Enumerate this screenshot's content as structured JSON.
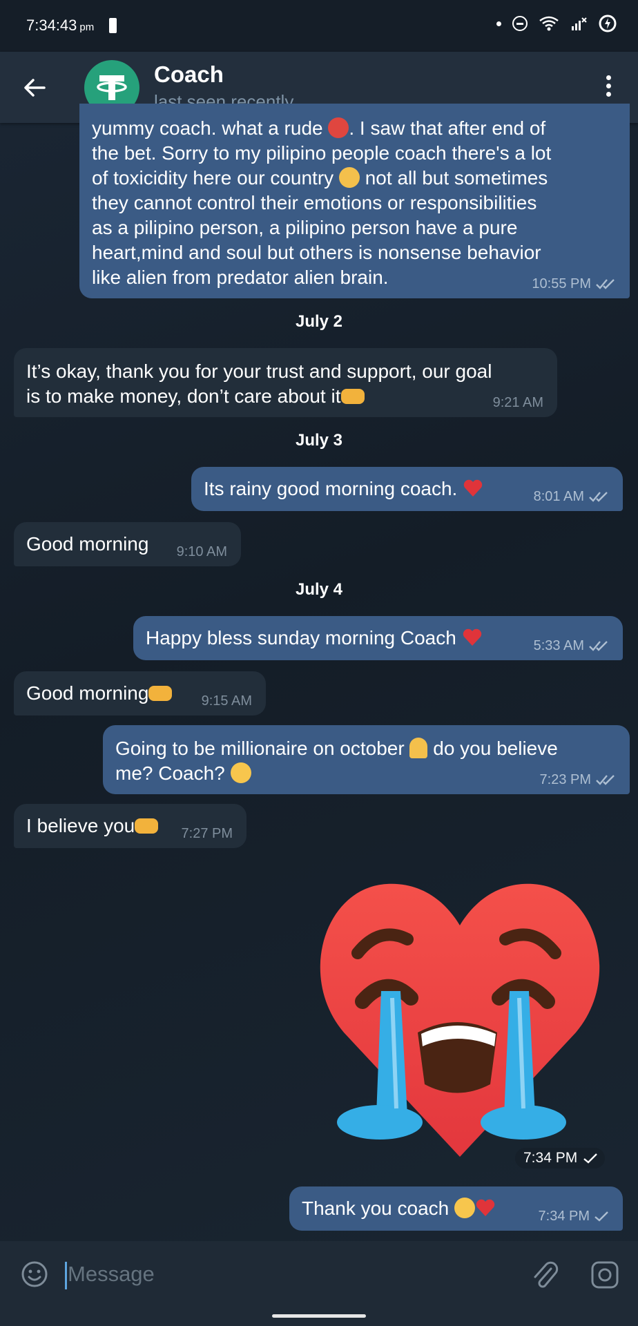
{
  "status_bar": {
    "time": "7:34:43",
    "ampm": "pm"
  },
  "header": {
    "title": "Coach",
    "subtitle": "last seen recently"
  },
  "messages": {
    "m1": {
      "line1": "yummy coach. what a rude",
      "line1b": ". I saw that after end of",
      "line2": "the bet. Sorry to my pilipino people coach there's a lot",
      "line3a": "of toxicidity here our country",
      "line3b": "not all but sometimes",
      "line4": "they cannot control their emotions or responsibilities",
      "line5": "as a pilipino person, a pilipino person have a pure",
      "line6": "heart,mind and soul but others is nonsense behavior",
      "line7": "like alien from predator alien brain.",
      "time": "10:55 PM"
    },
    "date1": "July 2",
    "m2": {
      "line1": "It’s okay, thank you for your trust and support, our goal",
      "line2": "is to make money, don’t care about it",
      "time": "9:21 AM"
    },
    "date2": "July 3",
    "m3": {
      "text": "Its rainy good morning coach.",
      "time": "8:01 AM"
    },
    "m4": {
      "text": "Good morning",
      "time": "9:10 AM"
    },
    "date3": "July 4",
    "m5": {
      "text": "Happy bless sunday morning Coach",
      "time": "5:33 AM"
    },
    "m6": {
      "text": "Good morning",
      "time": "9:15 AM"
    },
    "m7": {
      "line1a": "Going to be millionaire on october",
      "line1b": "do you believe",
      "line2": "me? Coach?",
      "time": "7:23 PM"
    },
    "m8": {
      "text": "I believe you",
      "time": "7:27 PM"
    },
    "sticker": {
      "time": "7:34 PM",
      "icon": "crying-heart-sticker"
    },
    "m9": {
      "text": "Thank you coach",
      "time": "7:34 PM"
    }
  },
  "input": {
    "placeholder": "Message"
  },
  "colors": {
    "outgoing_bubble": "#3b5b85",
    "incoming_bubble": "#222e3a",
    "header": "#232f3d",
    "avatar": "#26a17b"
  }
}
